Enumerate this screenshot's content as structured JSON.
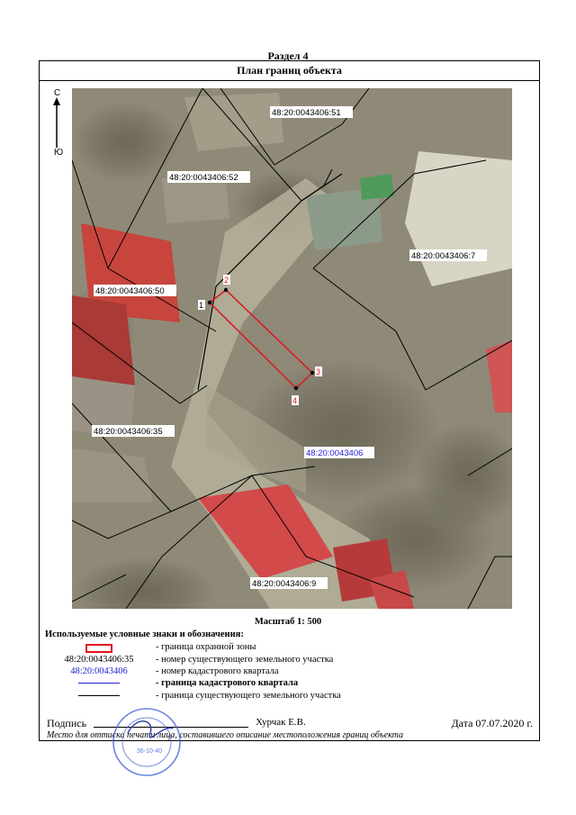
{
  "section_title": "Раздел 4",
  "plan_title": "План границ объекта",
  "compass": {
    "north": "С",
    "south": "Ю"
  },
  "map": {
    "parcels": [
      {
        "id": "p51",
        "label": "48:20:0043406:51"
      },
      {
        "id": "p52",
        "label": "48:20:0043406:52"
      },
      {
        "id": "p7",
        "label": "48:20:0043406:7"
      },
      {
        "id": "p50",
        "label": "48:20:0043406:50"
      },
      {
        "id": "p35",
        "label": "48:20:0043406:35"
      },
      {
        "id": "p9",
        "label": "48:20:0043406:9"
      }
    ],
    "quarter_label": "48:20:0043406",
    "points": [
      "1",
      "2",
      "3",
      "4"
    ],
    "colors": {
      "zone": "#e0141e",
      "quarter": "#1f1fd1",
      "boundary": "#000000"
    }
  },
  "scale_text": "Масштаб 1: 500",
  "legend": {
    "title": "Используемые условные знаки и обозначения:",
    "items": [
      {
        "symbol": "red-rect",
        "symbol_text": "",
        "desc": "- граница  охранной зоны"
      },
      {
        "symbol": "text",
        "symbol_text": "48:20:0043406:35",
        "desc": "- номер существующего земельного участка"
      },
      {
        "symbol": "blue-text",
        "symbol_text": "48:20:0043406",
        "desc": "- номер кадастрового квартала"
      },
      {
        "symbol": "blue-line",
        "symbol_text": "",
        "desc": "- граница кадастрового квартала"
      },
      {
        "symbol": "black-line",
        "symbol_text": "",
        "desc": "- граница существующего земельного участка"
      }
    ]
  },
  "signature": {
    "label": "Подпись",
    "name": "Хурчак Е.В.",
    "date": "Дата 07.07.2020 г.",
    "caption": "Место для оттиска печати лица, составившего описание местоположения границ объекта"
  },
  "stamp": {
    "code": "36-10-40"
  }
}
